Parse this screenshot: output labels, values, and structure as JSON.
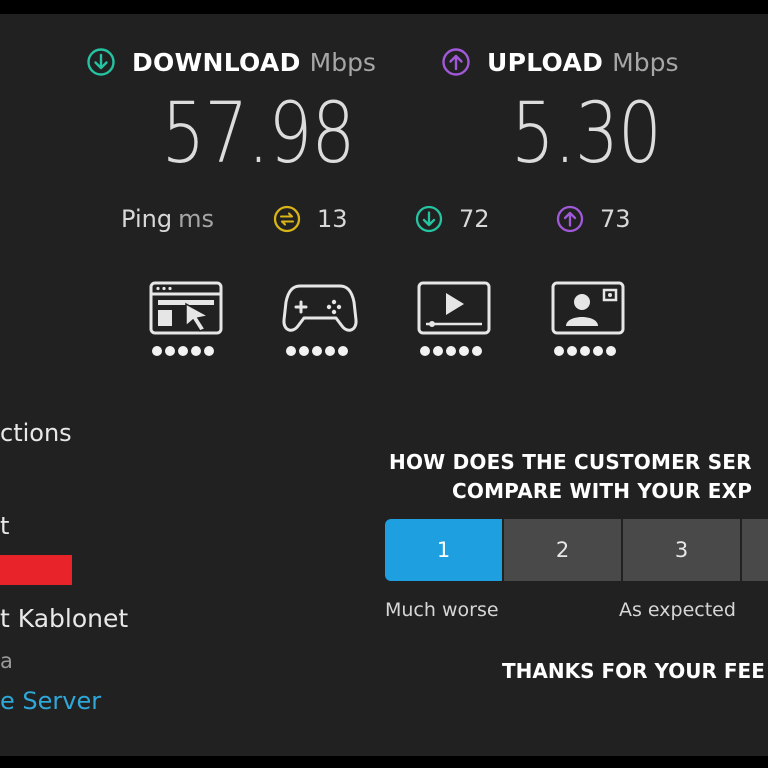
{
  "results": {
    "download": {
      "label": "DOWNLOAD",
      "unit": "Mbps",
      "value": "57.98",
      "icon": "download-arrow-icon",
      "color": "#24c3a1"
    },
    "upload": {
      "label": "UPLOAD",
      "unit": "Mbps",
      "value": "5.30",
      "icon": "upload-arrow-icon",
      "color": "#a259d9"
    }
  },
  "ping": {
    "label": "Ping",
    "unit": "ms",
    "idle": {
      "value": "13",
      "icon": "idle-latency-icon",
      "color": "#d8b416"
    },
    "download": {
      "value": "72",
      "icon": "download-latency-icon",
      "color": "#24c3a1"
    },
    "upload": {
      "value": "73",
      "icon": "upload-latency-icon",
      "color": "#a259d9"
    }
  },
  "activities": [
    {
      "name": "web-browsing-icon",
      "rating": 5
    },
    {
      "name": "gaming-icon",
      "rating": 5
    },
    {
      "name": "video-streaming-icon",
      "rating": 5
    },
    {
      "name": "video-call-icon",
      "rating": 5
    }
  ],
  "connection": {
    "connections_label": "ctions",
    "isp_label": "t",
    "host_name": "t Kablonet",
    "host_location": "a",
    "change_server": "e Server"
  },
  "survey": {
    "question_line1": "HOW DOES THE CUSTOMER SER",
    "question_line2": "COMPARE WITH YOUR EXP",
    "ratings": [
      "1",
      "2",
      "3",
      ""
    ],
    "selected": "1",
    "low_label": "Much worse",
    "mid_label": "As expected",
    "thanks": "THANKS FOR YOUR FEE"
  },
  "colors": {
    "background": "#212121",
    "accent_blue": "#1e9fe0",
    "link": "#2fa8d9",
    "redaction": "#e8232a"
  }
}
